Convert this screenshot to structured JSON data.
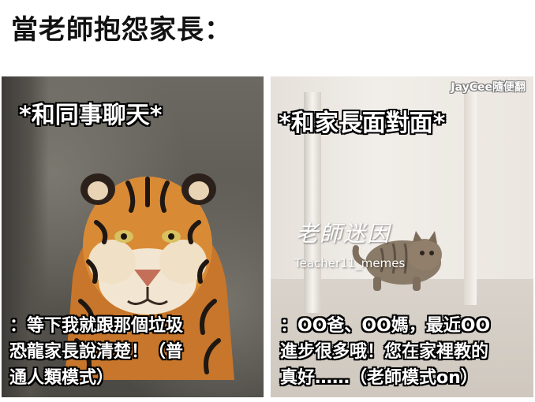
{
  "title": "當老師抱怨家長：",
  "left_panel": {
    "top_caption": "*和同事聊天*",
    "bottom_caption": [
      "：等下我就跟那個垃圾",
      "恐龍家長說清楚！（普",
      "通人類模式）"
    ]
  },
  "right_panel": {
    "credit": "JayCee隨便翻",
    "top_caption": "*和家長面對面*",
    "watermark_title": "老師迷因",
    "watermark_handle": "Teacher11_memes",
    "bottom_caption": [
      "：OO爸、OO媽，最近OO",
      "進步很多哦！您在家裡教的",
      "真好……（老師模式on）"
    ]
  }
}
